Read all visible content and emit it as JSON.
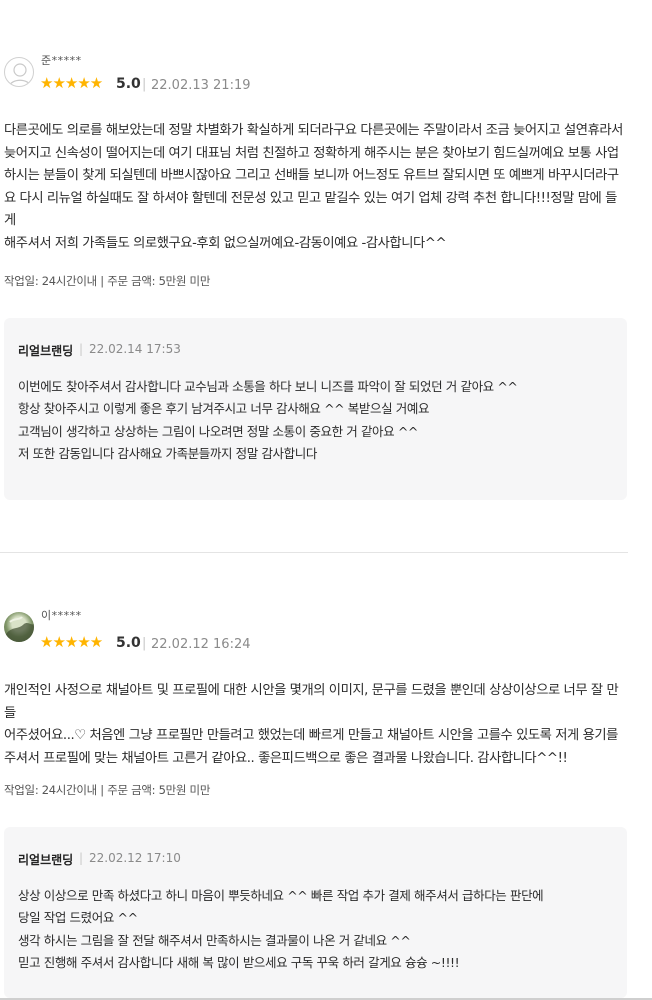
{
  "reviews": [
    {
      "username": "준*****",
      "stars": "★★★★★",
      "score": "5.0",
      "separator": "|",
      "date": "22.02.13 21:19",
      "body": "다른곳에도 의로를 해보았는데 정말 차별화가 확실하게 되더라구요 다른곳에는 주말이라서 조금 늦어지고 설연휴라서\n늦어지고 신속성이 떨어지는데 여기 대표님 처럼 친절하고 정확하게 해주시는 분은 찾아보기 힘드실꺼예요 보통 사업\n하시는 분들이 찾게 되실텐데 바쁘시잖아요 그리고 선배들 보니까 어느정도 유트브 잘되시면 또 예쁘게 바꾸시더라구\n요 다시 리뉴얼 하실때도 잘 하셔야 할텐데 전문성 있고 믿고 맡길수 있는 여기 업체 강력 추천 합니다!!!정말 맘에 들게\n해주셔서 저희 가족들도 의로했구요-후회 없으실꺼예요-감동이예요 -감사합니다^^",
      "meta": "작업일: 24시간이내 | 주문 금액: 5만원 미만",
      "reply": {
        "author": "리얼브랜딩",
        "separator": "|",
        "date": "22.02.14 17:53",
        "text": "이번에도 찾아주셔서 감사합니다 교수님과 소통을 하다 보니 니즈를 파악이 잘 되었던 거 같아요 ^^\n항상 찾아주시고 이렇게 좋은 후기 남겨주시고 너무 감사해요 ^^ 복받으실 거예요\n고객님이 생각하고 상상하는 그림이 나오려면 정말 소통이 중요한 거 같아요 ^^\n저 또한 감동입니다 감사해요 가족분들까지 정말 감사합니다"
      }
    },
    {
      "username": "이*****",
      "stars": "★★★★★",
      "score": "5.0",
      "separator": "|",
      "date": "22.02.12 16:24",
      "body": "개인적인 사정으로 채널아트 및 프로필에 대한 시안을 몇개의 이미지, 문구를 드렸을 뿐인데 상상이상으로 너무 잘 만들\n어주셨어요...♡ 처음엔 그냥 프로필만 만들려고 했었는데 빠르게 만들고 채널아트 시안을 고를수 있도록 저게 용기를\n주셔서 프로필에 맞는 채널아트 고른거 같아요.. 좋은피드백으로 좋은 결과물 나왔습니다. 감사합니다^^!!",
      "meta": "작업일: 24시간이내 | 주문 금액: 5만원 미만",
      "reply": {
        "author": "리얼브랜딩",
        "separator": "|",
        "date": "22.02.12 17:10",
        "text": "상상 이상으로 만족 하셨다고 하니 마음이 뿌듯하네요 ^^ 빠른 작업 추가 결제 해주셔서 급하다는 판단에\n당일 작업 드렸어요 ^^\n생각 하시는 그림을 잘 전달 해주셔서 만족하시는 결과물이 나온 거 같네요 ^^\n믿고 진행해 주셔서 감사합니다 새해 복 많이 받으세요  구독 꾸욱 하러 갈게요 슝슝 ~!!!!"
      }
    }
  ]
}
